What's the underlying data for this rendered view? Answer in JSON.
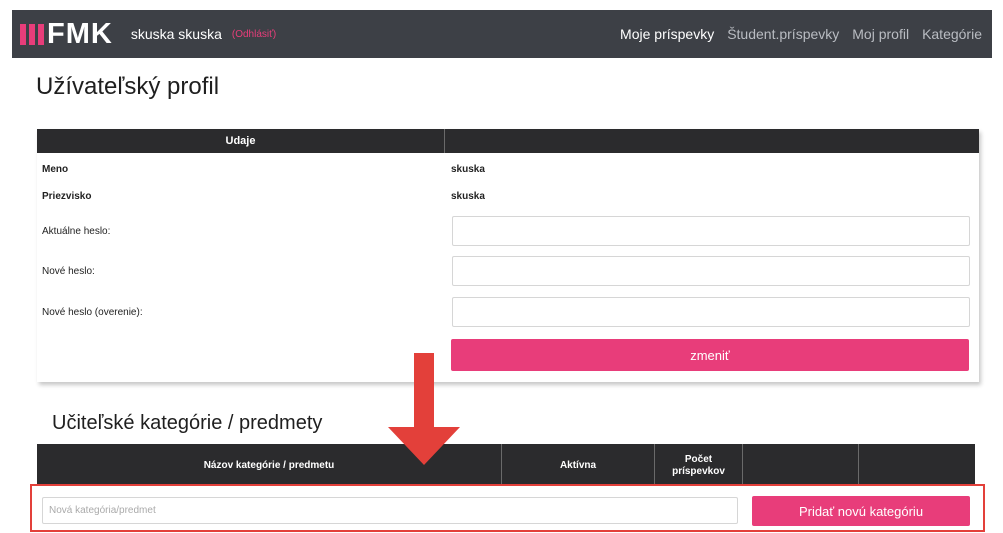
{
  "brand": {
    "logo_text": "FMK",
    "accent_color": "#e83d7a",
    "navbar_color": "#3d4046"
  },
  "navbar": {
    "user_name": "skuska skuska",
    "logout_label": "(Odhlásiť)",
    "links": [
      {
        "label": "Moje príspevky",
        "active": true
      },
      {
        "label": "Študent.príspevky",
        "active": false
      },
      {
        "label": "Moj profil",
        "active": false
      },
      {
        "label": "Kategórie",
        "active": false
      }
    ]
  },
  "page": {
    "title": "Užívateľský profil"
  },
  "profile": {
    "header": "Udaje",
    "name_label": "Meno",
    "name_value": "skuska",
    "surname_label": "Priezvisko",
    "surname_value": "skuska",
    "current_password_label": "Aktuálne heslo:",
    "new_password_label": "Nové heslo:",
    "confirm_password_label": "Nové heslo (overenie):",
    "change_button": "zmeniť"
  },
  "categories": {
    "title": "Učiteľské kategórie / predmety",
    "columns": [
      "Názov kategórie / predmetu",
      "Aktívna",
      "Počet príspevkov",
      "",
      ""
    ],
    "new_placeholder": "Nová kategória/predmet",
    "add_button": "Pridať novú kategóriu"
  },
  "annotation": {
    "arrow_color": "#e3403a",
    "highlight_color": "#e3403a"
  }
}
